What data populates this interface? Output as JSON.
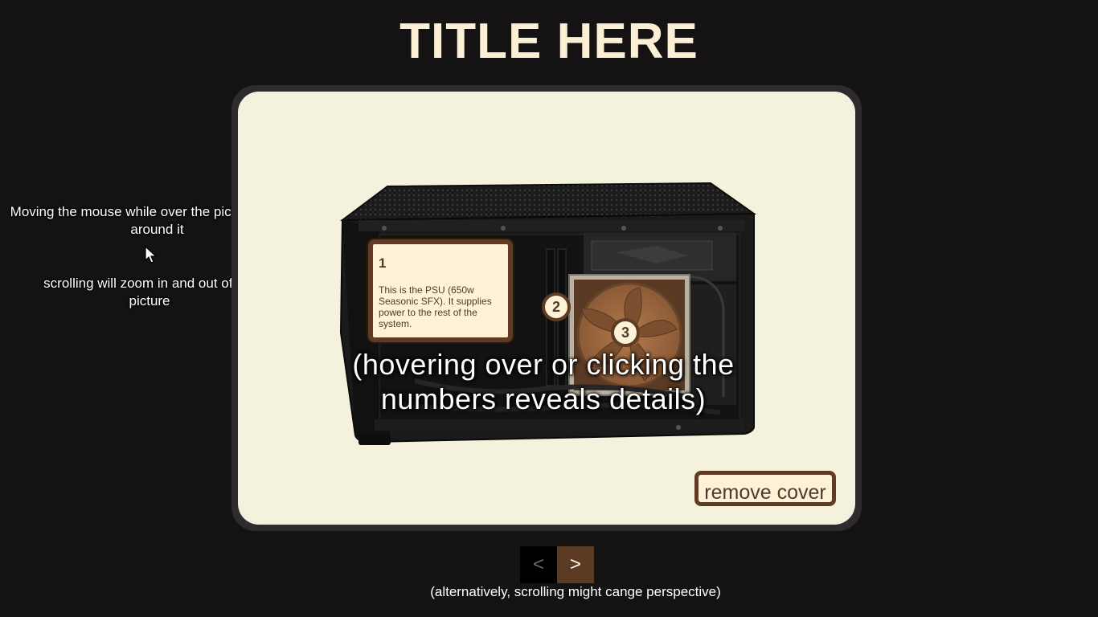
{
  "page": {
    "title": "TITLE HERE"
  },
  "hints": {
    "pan": "Moving the mouse while over the picture will pan around it",
    "zoom": "scrolling will zoom in and out of the picture",
    "bottom": "(alternatively, scrolling might cange perspective)"
  },
  "viewer": {
    "overlay_text": "(hovering over or clicking the numbers reveals details)",
    "card": {
      "number": "1",
      "text": "This is the PSU (650w Seasonic SFX). It supplies power to the rest of the system."
    },
    "markers": [
      "2",
      "3"
    ],
    "remove_cover_label": "remove cover"
  },
  "nav": {
    "prev_label": "<",
    "next_label": ">"
  },
  "colors": {
    "background": "#141212",
    "title": "#fbefd6",
    "viewer_bg": "#f4f2dc",
    "accent_brown": "#5e3b22",
    "card_bg": "#fdf1d6"
  },
  "icons": {
    "cursor": "mouse-pointer-icon"
  }
}
